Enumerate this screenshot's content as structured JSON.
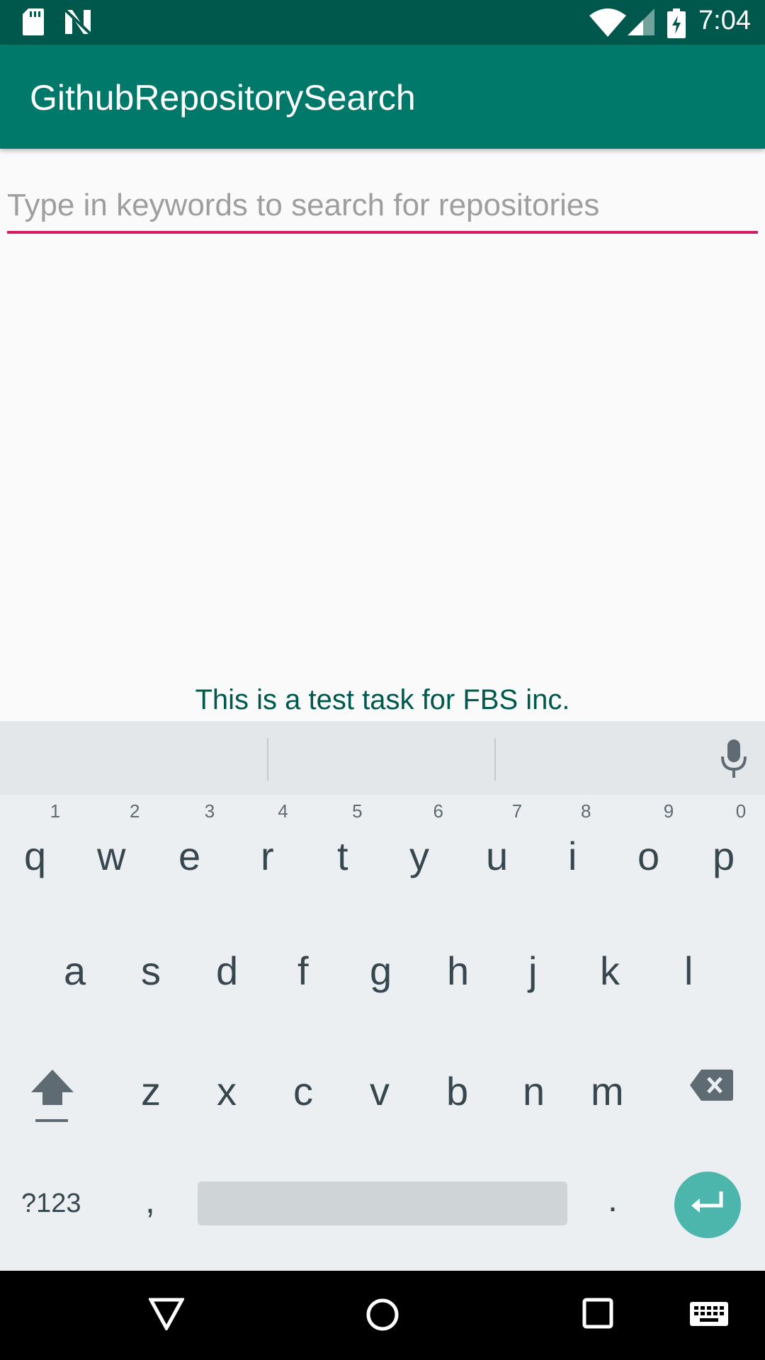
{
  "status_bar": {
    "time": "7:04",
    "icons": [
      "sd-card-icon",
      "notification-n-icon",
      "wifi-icon",
      "cell-signal-icon",
      "battery-charging-icon"
    ]
  },
  "app_bar": {
    "title": "GithubRepositorySearch"
  },
  "search": {
    "placeholder": "Type in keywords to search for repositories",
    "value": ""
  },
  "footer": {
    "text": "This is a test task for FBS inc."
  },
  "keyboard": {
    "row1": [
      {
        "key": "q",
        "hint": "1"
      },
      {
        "key": "w",
        "hint": "2"
      },
      {
        "key": "e",
        "hint": "3"
      },
      {
        "key": "r",
        "hint": "4"
      },
      {
        "key": "t",
        "hint": "5"
      },
      {
        "key": "y",
        "hint": "6"
      },
      {
        "key": "u",
        "hint": "7"
      },
      {
        "key": "i",
        "hint": "8"
      },
      {
        "key": "o",
        "hint": "9"
      },
      {
        "key": "p",
        "hint": "0"
      }
    ],
    "row2": [
      "a",
      "s",
      "d",
      "f",
      "g",
      "h",
      "j",
      "k",
      "l"
    ],
    "row3": [
      "z",
      "x",
      "c",
      "v",
      "b",
      "n",
      "m"
    ],
    "symbols_label": "?123",
    "comma": ",",
    "period": "."
  },
  "nav_bar": {
    "buttons": [
      "back-icon",
      "home-icon",
      "recents-icon",
      "keyboard-switch-icon"
    ]
  },
  "colors": {
    "status_bar": "#00574b",
    "app_bar": "#00796b",
    "accent_underline": "#d81b60",
    "footer_text": "#00574b",
    "enter_key": "#4db6ac"
  }
}
